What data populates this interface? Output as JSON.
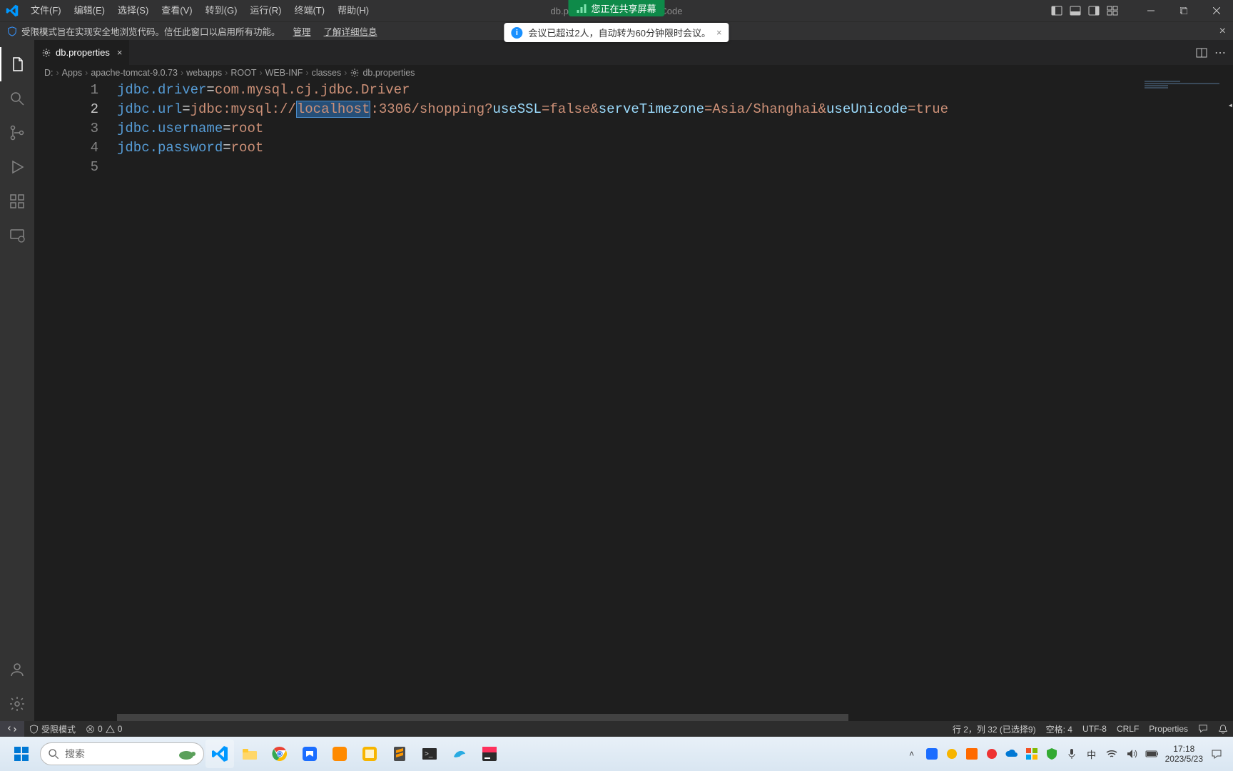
{
  "titlebar": {
    "menus": [
      "文件(F)",
      "编辑(E)",
      "选择(S)",
      "查看(V)",
      "转到(G)",
      "运行(R)",
      "终端(T)",
      "帮助(H)"
    ],
    "center_prefix": "db.pr",
    "center_suffix": "Code"
  },
  "share_banner": {
    "text": "您正在共享屏幕"
  },
  "restricted": {
    "text": "受限模式旨在实现安全地浏览代码。信任此窗口以启用所有功能。",
    "manage": "管理",
    "learn_more": "了解详细信息"
  },
  "meeting_pill": {
    "text": "会议已超过2人，自动转为60分钟限时会议。"
  },
  "tab": {
    "label": "db.properties"
  },
  "breadcrumb": [
    "D:",
    "Apps",
    "apache-tomcat-9.0.73",
    "webapps",
    "ROOT",
    "WEB-INF",
    "classes",
    "db.properties"
  ],
  "code": {
    "lines": [
      {
        "key": "jdbc.driver",
        "eq": "=",
        "rest": "com.mysql.cj.jdbc.Driver"
      },
      {
        "key": "jdbc.url",
        "eq": "=",
        "pre": "jdbc:mysql://",
        "sel": "localhost",
        "mid": ":3306/shopping?",
        "p1": "useSSL",
        "v1": "=false&",
        "p2": "serveTimezone",
        "v2": "=Asia/Shanghai&",
        "p3": "useUnicode",
        "v3": "=true"
      },
      {
        "key": "jdbc.username",
        "eq": "=",
        "rest": "root"
      },
      {
        "key": "jdbc.password",
        "eq": "=",
        "rest": "root"
      },
      {
        "blank": ""
      }
    ]
  },
  "status": {
    "restricted_label": "受限模式",
    "errors": "0",
    "warnings": "0",
    "cursor": "行 2，列 32 (已选择9)",
    "spaces": "空格: 4",
    "encoding": "UTF-8",
    "eol": "CRLF",
    "language": "Properties"
  },
  "taskbar": {
    "search_placeholder": "搜索",
    "ime": "中",
    "time": "17:18",
    "date": "2023/5/23"
  }
}
